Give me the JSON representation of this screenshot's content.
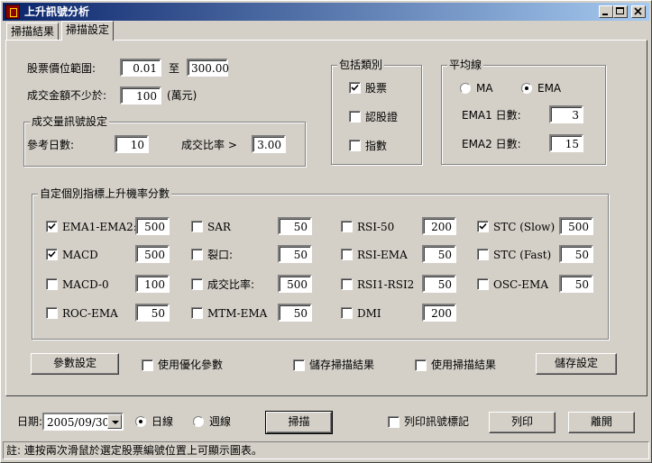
{
  "window": {
    "title": "上升訊號分析"
  },
  "tabs": [
    {
      "label": "掃描結果"
    },
    {
      "label": "掃描設定"
    }
  ],
  "stock_filter": {
    "price_range_label": "股票價位範圍:",
    "price_min": "0.01",
    "to_label": "至",
    "price_max": "300.00",
    "amount_label": "成交金額不少於:",
    "amount_value": "100",
    "amount_unit": "(萬元)"
  },
  "volume_group": {
    "title": "成交量訊號設定",
    "ref_days_label": "參考日數:",
    "ref_days_value": "10",
    "ratio_label": "成交比率 >",
    "ratio_value": "3.00"
  },
  "category_group": {
    "title": "包括類別",
    "items": [
      {
        "label": "股票",
        "checked": true
      },
      {
        "label": "認股證",
        "checked": false
      },
      {
        "label": "指數",
        "checked": false
      }
    ]
  },
  "ma_group": {
    "title": "平均線",
    "ma_label": "MA",
    "ema_label": "EMA",
    "selected": "EMA",
    "ema1_label": "EMA1 日數:",
    "ema1_value": "3",
    "ema2_label": "EMA2 日數:",
    "ema2_value": "15"
  },
  "indicator_group": {
    "title": "自定個別指標上升機率分數",
    "rows": [
      [
        {
          "label": "EMA1-EMA2:",
          "checked": true,
          "value": "500"
        },
        {
          "label": "SAR",
          "checked": false,
          "value": "50"
        },
        {
          "label": "RSI-50",
          "checked": false,
          "value": "200"
        },
        {
          "label": "STC (Slow)",
          "checked": true,
          "value": "500"
        }
      ],
      [
        {
          "label": "MACD",
          "checked": true,
          "value": "500"
        },
        {
          "label": "裂口:",
          "checked": false,
          "value": "50"
        },
        {
          "label": "RSI-EMA",
          "checked": false,
          "value": "50"
        },
        {
          "label": "STC (Fast)",
          "checked": false,
          "value": "50"
        }
      ],
      [
        {
          "label": "MACD-0",
          "checked": false,
          "value": "100"
        },
        {
          "label": "成交比率:",
          "checked": false,
          "value": "500"
        },
        {
          "label": "RSI1-RSI2",
          "checked": false,
          "value": "50"
        },
        {
          "label": "OSC-EMA",
          "checked": false,
          "value": "50"
        }
      ],
      [
        {
          "label": "ROC-EMA",
          "checked": false,
          "value": "50"
        },
        {
          "label": "MTM-EMA",
          "checked": false,
          "value": "50"
        },
        {
          "label": "DMI",
          "checked": false,
          "value": "200"
        }
      ]
    ]
  },
  "settings_row": {
    "param_button": "參數設定",
    "use_optimized": "使用優化參數",
    "save_scan": "儲存掃描結果",
    "use_scan": "使用掃描結果",
    "save_settings_button": "儲存設定"
  },
  "bottom_bar": {
    "date_label": "日期:",
    "date_value": "2005/09/30",
    "daily_label": "日線",
    "weekly_label": "週線",
    "period_selected": "daily",
    "scan_button": "掃描",
    "print_marks": "列印訊號標記",
    "print_button": "列印",
    "exit_button": "離開"
  },
  "status_bar": {
    "text": "註: 連按兩次滑鼠於選定股票編號位置上可顯示圖表。"
  }
}
